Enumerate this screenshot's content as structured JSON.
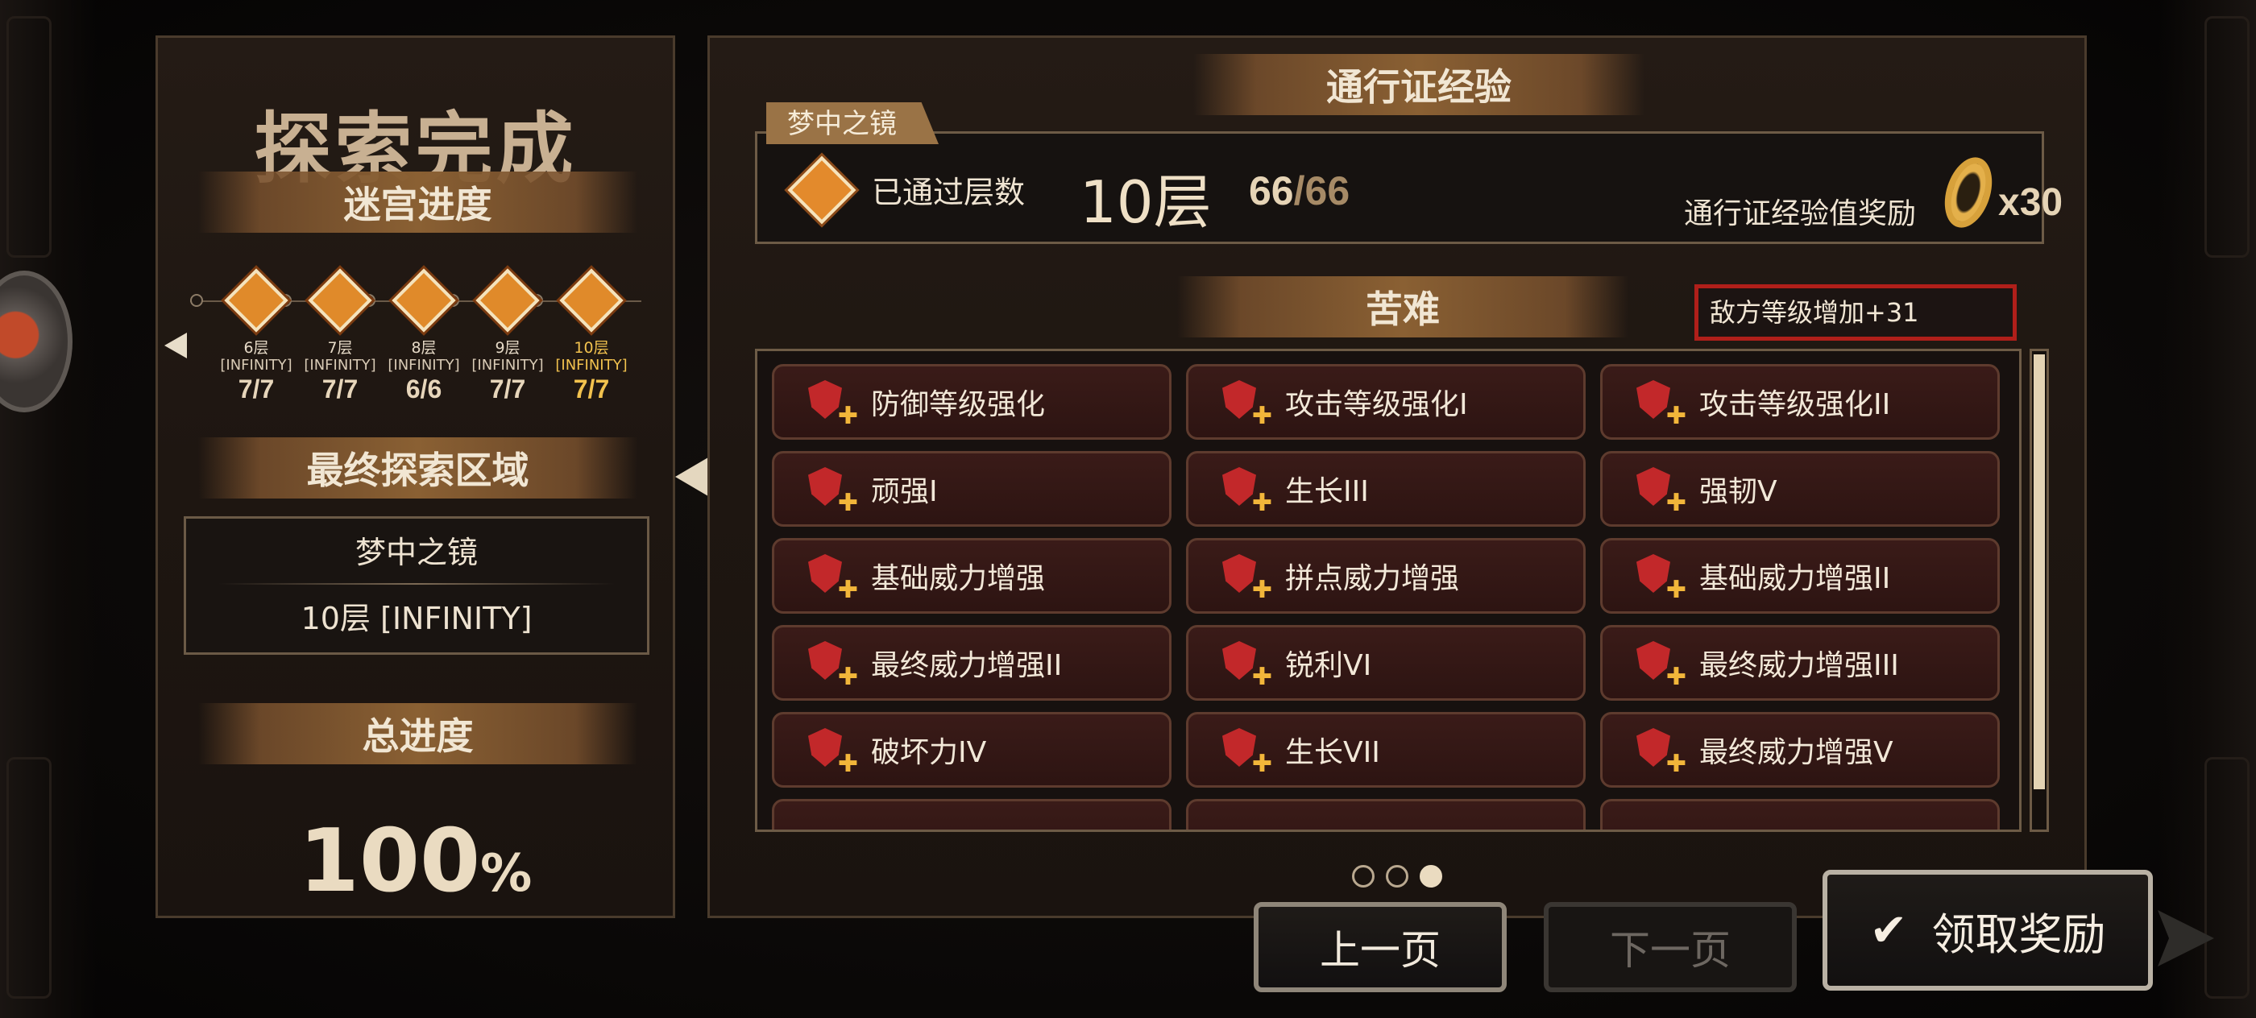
{
  "left": {
    "title": "探索完成",
    "labyrinth_progress": "迷宫进度",
    "nodes": [
      {
        "floor": "6层",
        "mode": "[INFINITY]",
        "done": "7",
        "total": "7",
        "active": false
      },
      {
        "floor": "7层",
        "mode": "[INFINITY]",
        "done": "7",
        "total": "7",
        "active": false
      },
      {
        "floor": "8层",
        "mode": "[INFINITY]",
        "done": "6",
        "total": "6",
        "active": false
      },
      {
        "floor": "9层",
        "mode": "[INFINITY]",
        "done": "7",
        "total": "7",
        "active": false
      },
      {
        "floor": "10层",
        "mode": "[INFINITY]",
        "done": "7",
        "total": "7",
        "active": true
      }
    ],
    "final_area_label": "最终探索区域",
    "final_area_name": "梦中之镜",
    "final_area_floor": "10层 [INFINITY]",
    "total_label": "总进度",
    "total_value": "100",
    "total_unit": "%"
  },
  "right": {
    "pass_exp_title": "通行证经验",
    "area_tab": "梦中之镜",
    "passed_label": "已通过层数",
    "passed_floor": "10层",
    "passed_count": "66",
    "passed_max": "66",
    "reward_label": "通行证经验值奖励",
    "reward_multiplier": "x30",
    "hardship_title": "苦难",
    "enemy_level": "敌方等级增加+31",
    "modifiers": [
      "防御等级强化",
      "攻击等级强化I",
      "攻击等级强化II",
      "顽强I",
      "生长III",
      "强韧V",
      "基础威力增强",
      "拼点威力增强",
      "基础威力增强II",
      "最终威力增强II",
      "锐利VI",
      "最终威力增强III",
      "破坏力IV",
      "生长VII",
      "最终威力增强V"
    ],
    "pages": 3,
    "current_page": 3
  },
  "buttons": {
    "prev": "上一页",
    "next": "下一页",
    "claim": "领取奖励"
  },
  "colors": {
    "accent_gold": "#f2c24e",
    "enemy_border": "#b01f1a",
    "cell_bg": "#2d1412"
  }
}
